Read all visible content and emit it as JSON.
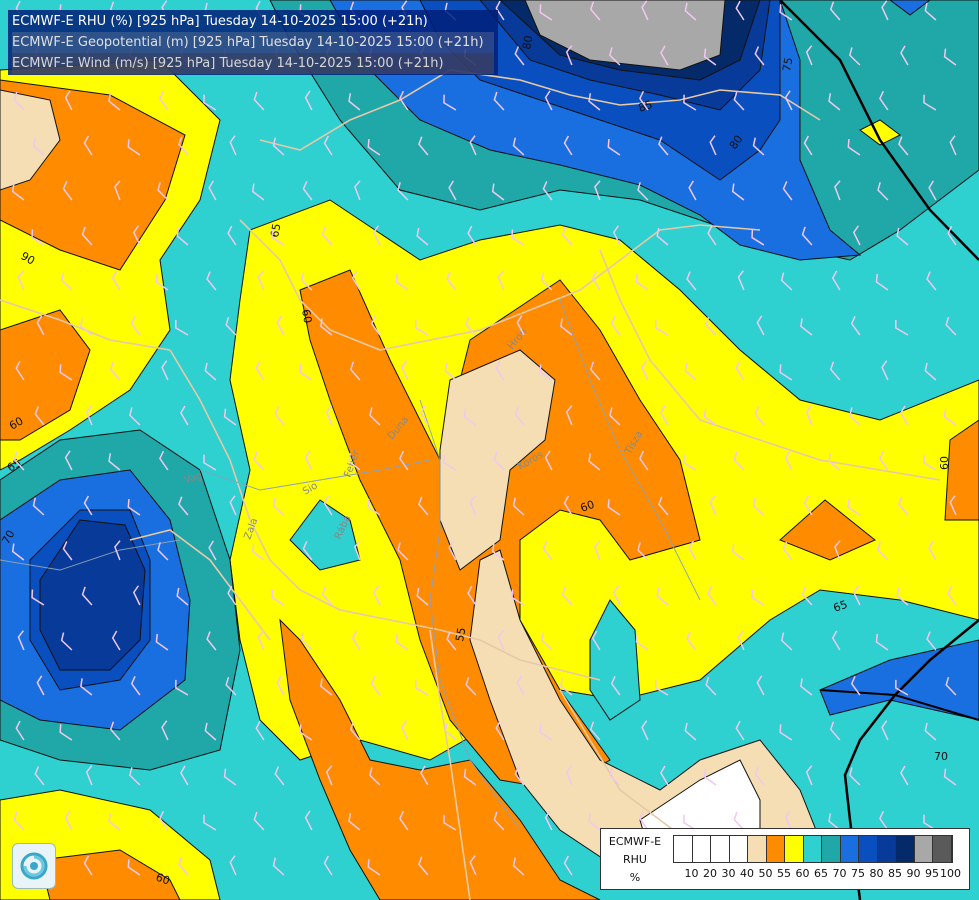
{
  "header": {
    "line1": "ECMWF-E RHU (%) [925 hPa] Tuesday 14-10-2025 15:00 (+21h)",
    "line2": "ECMWF-E Geopotential (m) [925 hPa] Tuesday 14-10-2025 15:00 (+21h)",
    "line3": "ECMWF-E Wind (m/s) [925 hPa] Tuesday 14-10-2025 15:00 (+21h)"
  },
  "contour_labels": [
    "80",
    "85",
    "75",
    "80",
    "65",
    "60",
    "90",
    "60",
    "65",
    "60",
    "55",
    "60",
    "65",
    "70",
    "60",
    "70"
  ],
  "river_labels": [
    "Vag",
    "Hron",
    "Tisza",
    "Sio",
    "Zala",
    "Duna",
    "Körös",
    "Feher",
    "Rába"
  ],
  "legend": {
    "title1": "ECMWF-E",
    "title2": "RHU",
    "unit": "%",
    "ticks": [
      "10",
      "20",
      "30",
      "40",
      "50",
      "55",
      "60",
      "65",
      "70",
      "75",
      "80",
      "85",
      "90",
      "95",
      "100"
    ],
    "colors": [
      "#ffffff",
      "#ffffff",
      "#ffffff",
      "#ffffff",
      "#f5deb3",
      "#ff8c00",
      "#ffff00",
      "#2ed0d0",
      "#20a8a8",
      "#1a6fe0",
      "#0a4fc0",
      "#083a9a",
      "#052a6a",
      "#a8a8a8",
      "#5a5a5a"
    ]
  },
  "colors": {
    "rhu_50": "#f5deb3",
    "rhu_55": "#ff8c00",
    "rhu_60": "#ffff00",
    "rhu_65": "#2ed0d0",
    "rhu_70": "#20a8a8",
    "rhu_75": "#1a6fe0",
    "rhu_80": "#0a4fc0",
    "rhu_85": "#083a9a",
    "rhu_90": "#052a6a",
    "rhu_95": "#a8a8a8"
  }
}
